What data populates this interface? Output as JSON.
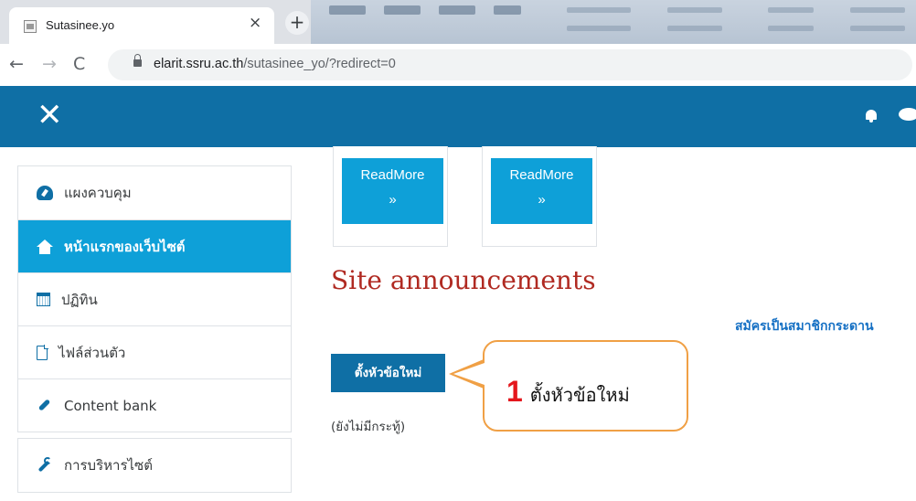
{
  "browser": {
    "tab_title": "Sutasinee.yo",
    "tab_close": "×",
    "new_tab": "+",
    "back": "←",
    "forward": "→",
    "reload": "C",
    "url_host": "elarit.ssru.ac.th",
    "url_path": "/sutasinee_yo/?redirect=0"
  },
  "navbar": {
    "close_glyph": "✕",
    "icons": [
      "bell-icon",
      "chat-icon"
    ],
    "color": "#0f6fa5"
  },
  "sidebar": {
    "items": [
      {
        "label": "แผงควบคุม",
        "icon": "dashboard-icon"
      },
      {
        "label": "หน้าแรกของเว็บไซต์",
        "icon": "home-icon",
        "active": true
      },
      {
        "label": "ปฏิทิน",
        "icon": "calendar-icon"
      },
      {
        "label": "ไฟล์ส่วนตัว",
        "icon": "file-icon"
      },
      {
        "label": "Content bank",
        "icon": "paintbrush-icon"
      }
    ],
    "admin": {
      "label": "การบริหารไซต์",
      "icon": "wrench-icon"
    },
    "active_color": "#0ea0d8"
  },
  "main": {
    "cards": [
      {
        "button": "ReadMore",
        "arrow": "»"
      },
      {
        "button": "ReadMore",
        "arrow": "»"
      }
    ],
    "section_title": "Site announcements",
    "subscribe_link": "สมัครเป็นสมาชิกกระดาน",
    "new_topic_button": "ตั้งหัวข้อใหม่",
    "no_posts": "(ยังไม่มีกระทู้)",
    "title_color": "#b02a22"
  },
  "callout": {
    "number": "1",
    "label": "ตั้งหัวข้อใหม่",
    "border_color": "#f0a045",
    "number_color": "#e4171d"
  }
}
